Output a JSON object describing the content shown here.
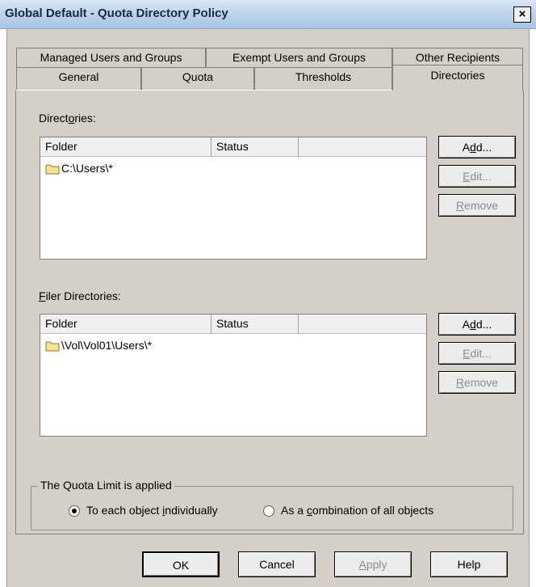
{
  "window": {
    "title": "Global Default - Quota Directory Policy",
    "close_label": "×"
  },
  "tabs_row1": [
    {
      "label": "Managed Users and Groups"
    },
    {
      "label": "Exempt Users and Groups"
    },
    {
      "label": "Other Recipients"
    }
  ],
  "tabs_row2": [
    {
      "label": "General"
    },
    {
      "label": "Quota"
    },
    {
      "label": "Thresholds"
    },
    {
      "label": "Directories",
      "active": true
    }
  ],
  "directories": {
    "label_pre": "Direct",
    "label_accel": "o",
    "label_post": "ries:",
    "columns": [
      "Folder",
      "Status"
    ],
    "rows": [
      {
        "folder": "C:\\Users\\*",
        "status": ""
      }
    ],
    "buttons": {
      "add": {
        "pre": "A",
        "accel": "d",
        "post": "d..."
      },
      "edit": {
        "pre": "",
        "accel": "E",
        "post": "dit..."
      },
      "remove": {
        "pre": "",
        "accel": "R",
        "post": "emove"
      }
    }
  },
  "filer_directories": {
    "label_accel": "F",
    "label_post": "iler Directories:",
    "columns": [
      "Folder",
      "Status"
    ],
    "rows": [
      {
        "folder": "\\Vol\\Vol01\\Users\\*",
        "status": ""
      }
    ],
    "buttons": {
      "add": {
        "pre": "A",
        "accel": "d",
        "post": "d..."
      },
      "edit": {
        "pre": "",
        "accel": "E",
        "post": "dit..."
      },
      "remove": {
        "pre": "",
        "accel": "R",
        "post": "emove"
      }
    }
  },
  "quota_limit": {
    "group_title": "The Quota Limit is applied",
    "option1": {
      "pre": "To each object ",
      "accel": "i",
      "post": "ndividually",
      "selected": true
    },
    "option2": {
      "pre": "As a ",
      "accel": "c",
      "post": "ombination of all objects",
      "selected": false
    }
  },
  "footer": {
    "ok": "OK",
    "cancel": "Cancel",
    "apply": {
      "accel": "A",
      "post": "pply"
    },
    "help": "Help"
  },
  "colors": {
    "dialog_bg": "#d4d0c8",
    "title_grad_top": "#d8e6f5",
    "title_grad_bottom": "#a9c5e6",
    "folder_icon": "#f5e48c",
    "disabled_text": "#8c8c8c"
  }
}
